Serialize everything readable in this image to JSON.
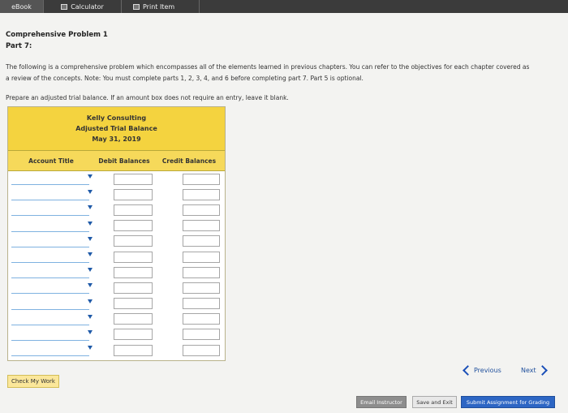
{
  "topbar": {
    "tabs": [
      {
        "label": "eBook",
        "icon": "book-icon"
      },
      {
        "label": "Calculator",
        "icon": "calculator-icon"
      },
      {
        "label": "Print Item",
        "icon": "printer-icon"
      }
    ]
  },
  "problem": {
    "title": "Comprehensive Problem 1",
    "part": "Part 7:",
    "intro_line1": "The following is a comprehensive problem which encompasses all of the elements learned in previous chapters. You can refer to the objectives for each chapter covered as",
    "intro_line2": "a review of the concepts. Note: You must complete parts 1, 2, 3, 4, and 6 before completing part 7. Part 5 is optional.",
    "instruction": "Prepare an adjusted trial balance. If an amount box does not require an entry, leave it blank."
  },
  "trial_balance": {
    "company": "Kelly Consulting",
    "statement": "Adjusted Trial Balance",
    "date": "May 31, 2019",
    "columns": [
      "Account Title",
      "Debit Balances",
      "Credit Balances"
    ],
    "rows": [
      {
        "account": "",
        "debit": "",
        "credit": ""
      },
      {
        "account": "",
        "debit": "",
        "credit": ""
      },
      {
        "account": "",
        "debit": "",
        "credit": ""
      },
      {
        "account": "",
        "debit": "",
        "credit": ""
      },
      {
        "account": "",
        "debit": "",
        "credit": ""
      },
      {
        "account": "",
        "debit": "",
        "credit": ""
      },
      {
        "account": "",
        "debit": "",
        "credit": ""
      },
      {
        "account": "",
        "debit": "",
        "credit": ""
      },
      {
        "account": "",
        "debit": "",
        "credit": ""
      },
      {
        "account": "",
        "debit": "",
        "credit": ""
      },
      {
        "account": "",
        "debit": "",
        "credit": ""
      },
      {
        "account": "",
        "debit": "",
        "credit": ""
      }
    ]
  },
  "actions": {
    "check_my_work": "Check My Work",
    "previous": "Previous",
    "next": "Next",
    "email_instructor": "Email Instructor",
    "save_and_exit": "Save and Exit",
    "submit": "Submit Assignment for Grading"
  }
}
